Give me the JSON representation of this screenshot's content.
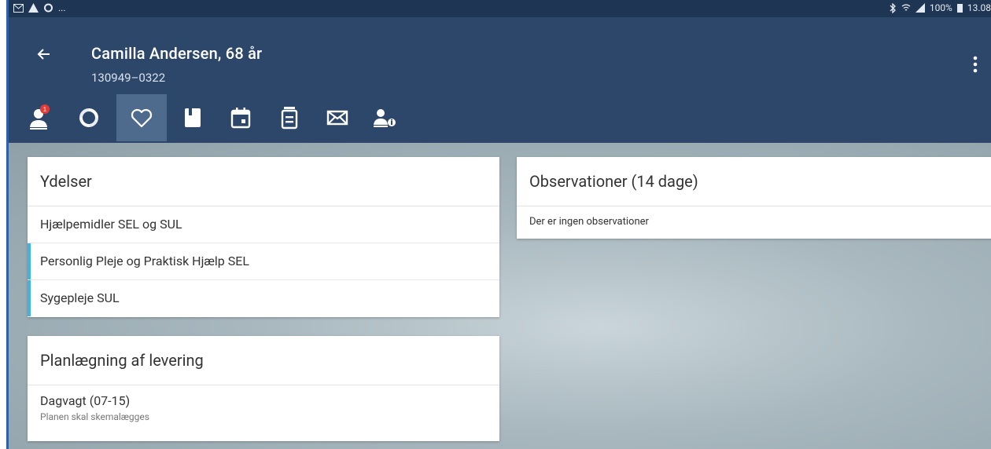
{
  "statusbar": {
    "left_text": "...",
    "battery": "100%",
    "time": "13.08"
  },
  "header": {
    "patient_name": "Camilla Andersen, 68 år",
    "patient_id": "130949–0322"
  },
  "tabs": [
    {
      "icon": "patient-alert-icon",
      "badge": "1"
    },
    {
      "icon": "cycle-icon"
    },
    {
      "icon": "heart-icon"
    },
    {
      "icon": "book-icon"
    },
    {
      "icon": "calendar-icon"
    },
    {
      "icon": "medicine-icon"
    },
    {
      "icon": "mail-icon"
    },
    {
      "icon": "person-info-icon"
    }
  ],
  "ydelser": {
    "title": "Ydelser",
    "items": [
      "Hjælpemidler SEL og SUL",
      "Personlig Pleje og Praktisk Hjælp SEL",
      "Sygepleje SUL"
    ]
  },
  "planlaegning": {
    "title": "Planlægning af levering",
    "item_title": "Dagvagt (07-15)",
    "item_sub": "Planen skal skemalægges"
  },
  "observationer": {
    "title": "Observationer (14 dage)",
    "empty_text": "Der er ingen observationer"
  },
  "colors": {
    "appbar": "#2d476b",
    "statusbar": "#1e3553",
    "accent": "#3db3e6",
    "badge": "#e53935"
  }
}
